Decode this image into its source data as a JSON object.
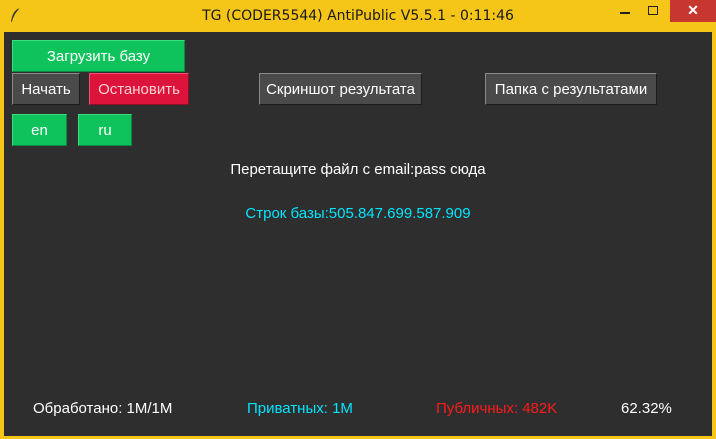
{
  "window": {
    "title": "TG (CODER5544) AntiPublic V5.5.1 - 0:11:46",
    "close_symbol": "✕"
  },
  "controls": {
    "load_base": "Загрузить базу",
    "start": "Начать",
    "stop": "Остановить",
    "screenshot": "Скриншот результата",
    "results_folder": "Папка с результатами",
    "lang_en": "en",
    "lang_ru": "ru"
  },
  "main": {
    "drop_hint": "Перетащите файл с email:pass сюда",
    "base_lines": "Строк базы:505.847.699.587.909"
  },
  "status": {
    "processed": "Обработано: 1M/1M",
    "private": "Приватных: 1M",
    "public": "Публичных: 482K",
    "percent": "62.32%"
  },
  "colors": {
    "background": "#2e2e2e",
    "titlebar": "#f5c518",
    "green_button": "#0fc35c",
    "red_button": "#dc143c",
    "gray_button": "#4a4a4a",
    "cyan_text": "#00e5ff",
    "red_text": "#ff1a1a",
    "close_button": "#c7372f"
  },
  "icons": {
    "app_icon": "feather-icon",
    "minimize": "minimize-icon",
    "maximize": "maximize-icon",
    "close": "close-icon"
  }
}
